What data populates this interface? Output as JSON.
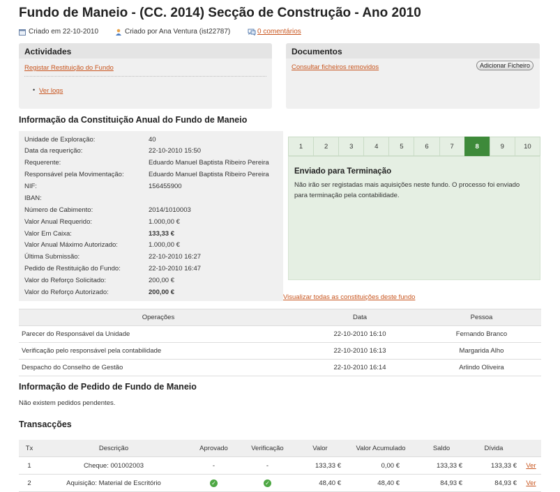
{
  "page": {
    "title": "Fundo de Maneio - (CC. 2014) Secção de Construção - Ano 2010",
    "created_on": "Criado em 22-10-2010",
    "created_by": "Criado por Ana Ventura (ist22787)",
    "comments_link": "0 comentários"
  },
  "actividades": {
    "title": "Actividades",
    "link_registar": "Registar Restituição do Fundo",
    "link_logs": "Ver logs"
  },
  "documentos": {
    "title": "Documentos",
    "link_removed": "Consultar ficheiros removidos",
    "add_button": "Adicionar Ficheiro"
  },
  "constituicao": {
    "title": "Informação da Constituição Anual do Fundo de Maneio",
    "rows": [
      {
        "label": "Unidade de Exploração:",
        "value": "40"
      },
      {
        "label": "Data da requerição:",
        "value": "22-10-2010 15:50"
      },
      {
        "label": "Requerente:",
        "value": "Eduardo Manuel Baptista Ribeiro Pereira"
      },
      {
        "label": "Responsável pela Movimentação:",
        "value": "Eduardo Manuel Baptista Ribeiro Pereira"
      },
      {
        "label": "NIF:",
        "value": "156455900"
      },
      {
        "label": "IBAN:",
        "value": ""
      },
      {
        "label": "Número de Cabimento:",
        "value": "2014/1010003"
      },
      {
        "label": "Valor Anual Requerido:",
        "value": "1.000,00 €"
      },
      {
        "label": "Valor Em Caixa:",
        "value": "133,33 €"
      },
      {
        "label": "Valor Anual Máximo Autorizado:",
        "value": "1.000,00 €"
      },
      {
        "label": "Última Submissão:",
        "value": "22-10-2010 16:27"
      },
      {
        "label": "Pedido de Restituição do Fundo:",
        "value": "22-10-2010 16:47"
      },
      {
        "label": "Valor do Reforço Solicitado:",
        "value": "200,00 €"
      },
      {
        "label": "Valor do Reforço Autorizado:",
        "value": "200,00 €"
      }
    ],
    "link_all": "Visualizar todas as constituições deste fundo"
  },
  "process": {
    "steps": [
      "1",
      "2",
      "3",
      "4",
      "5",
      "6",
      "7",
      "8",
      "9",
      "10"
    ],
    "active_step": "8",
    "status_title": "Enviado para Terminação",
    "status_text_1": "Não irão ser registadas mais aquisições neste fundo. O processo foi enviado",
    "status_text_2": "para terminação pela contabilidade."
  },
  "operacoes": {
    "headers": [
      "Operações",
      "Data",
      "Pessoa"
    ],
    "rows": [
      [
        "Parecer do Responsável da Unidade",
        "22-10-2010 16:10",
        "Fernando Branco"
      ],
      [
        "Verificação pelo responsável pela contabilidade",
        "22-10-2010 16:13",
        "Margarida Alho"
      ],
      [
        "Despacho do Conselho de Gestão",
        "22-10-2010 16:14",
        "Arlindo Oliveira"
      ]
    ]
  },
  "pedido": {
    "title": "Informação de Pedido de Fundo de Maneio",
    "text": "Não existem pedidos pendentes."
  },
  "transaccoes": {
    "title": "Transacções",
    "headers": [
      "Tx",
      "Descrição",
      "Aprovado",
      "Verificação",
      "Valor",
      "Valor Acumulado",
      "Saldo",
      "Dívida"
    ],
    "rows": [
      {
        "tx": "1",
        "desc": "Cheque: 001002003",
        "aprovado": "-",
        "verificacao": "-",
        "valor": "133,33 €",
        "acumulado": "0,00 €",
        "saldo": "133,33 €",
        "divida": "133,33 €",
        "link": "Ver"
      },
      {
        "tx": "2",
        "desc": "Aquisição: Material de Escritório",
        "aprovado": "check",
        "verificacao": "check",
        "valor": "48,40 €",
        "acumulado": "48,40 €",
        "saldo": "84,93 €",
        "divida": "84,93 €",
        "link": "Ver"
      }
    ]
  },
  "colors": {
    "accent_link": "#c8551e",
    "step_active": "#3e8a3a",
    "step_bg": "#e5efe3"
  }
}
